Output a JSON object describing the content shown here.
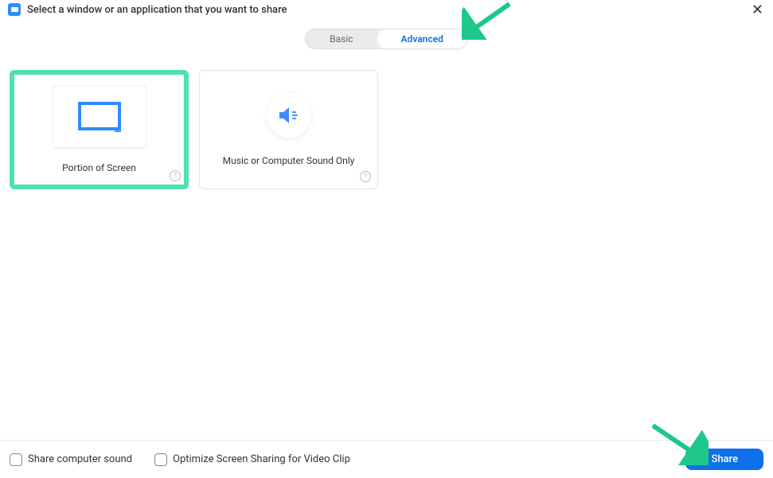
{
  "header": {
    "title": "Select a window or an application that you want to share"
  },
  "tabs": {
    "basic": "Basic",
    "advanced": "Advanced"
  },
  "options": {
    "portion": {
      "label": "Portion of Screen"
    },
    "sound": {
      "label": "Music or Computer Sound Only"
    }
  },
  "footer": {
    "shareSound": "Share computer sound",
    "optimizeVideo": "Optimize Screen Sharing for Video Clip",
    "shareButton": "Share"
  },
  "colors": {
    "accent": "#0E71EB",
    "highlight": "#4DE3AB",
    "arrow": "#1EC88A"
  }
}
